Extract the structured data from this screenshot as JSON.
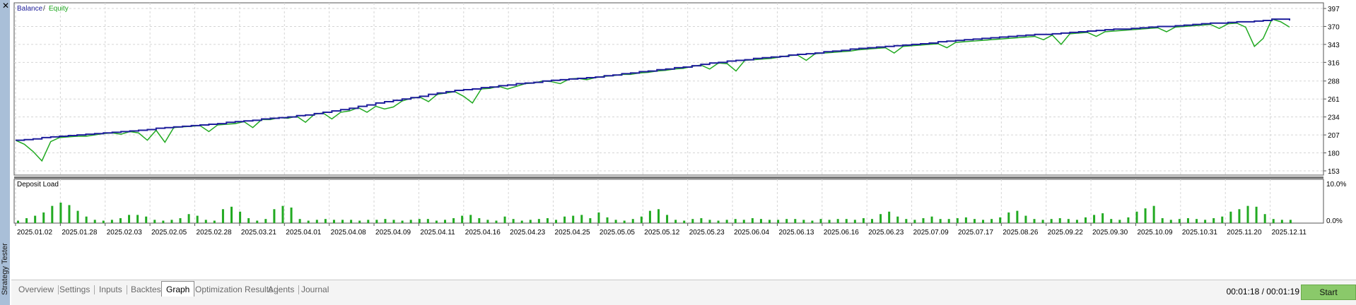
{
  "window": {
    "side_title": "Strategy Tester",
    "close_label": "✕"
  },
  "colors": {
    "balance": "#1f1f9c",
    "equity": "#22aa22",
    "grid": "#d5d5d5",
    "bars": "#22aa22"
  },
  "chart_data": [
    {
      "type": "line",
      "legend": [
        {
          "name": "Balance",
          "color": "#1f1f9c"
        },
        {
          "name": "Equity",
          "color": "#22aa22"
        }
      ],
      "legend_separator": "/",
      "y_ticks": [
        397,
        370,
        343,
        316,
        288,
        261,
        234,
        207,
        180,
        153
      ],
      "ylim": [
        153,
        397
      ],
      "x_ticks": [
        "2025.01.02",
        "2025.01.28",
        "2025.02.03",
        "2025.02.05",
        "2025.02.28",
        "2025.03.21",
        "2025.04.01",
        "2025.04.08",
        "2025.04.09",
        "2025.04.11",
        "2025.04.16",
        "2025.04.23",
        "2025.04.25",
        "2025.05.05",
        "2025.05.12",
        "2025.05.23",
        "2025.06.04",
        "2025.06.13",
        "2025.06.16",
        "2025.06.23",
        "2025.07.09",
        "2025.07.17",
        "2025.08.26",
        "2025.09.22",
        "2025.09.30",
        "2025.10.09",
        "2025.10.31",
        "2025.11.20",
        "2025.12.11"
      ],
      "x": [
        0,
        1,
        2,
        3,
        4,
        5,
        6,
        7,
        8,
        9,
        10,
        11,
        12,
        13,
        14,
        15,
        16,
        17,
        18,
        19,
        20,
        21,
        22,
        23,
        24,
        25,
        26,
        27,
        28,
        29,
        30,
        31,
        32,
        33,
        34,
        35,
        36,
        37,
        38,
        39,
        40,
        41,
        42,
        43,
        44,
        45,
        46,
        47,
        48,
        49,
        50,
        51,
        52,
        53,
        54,
        55,
        56,
        57,
        58,
        59,
        60,
        61,
        62,
        63,
        64,
        65,
        66,
        67,
        68,
        69,
        70,
        71,
        72,
        73,
        74,
        75,
        76,
        77,
        78,
        79,
        80,
        81,
        82,
        83,
        84,
        85,
        86,
        87,
        88,
        89,
        90,
        91,
        92,
        93,
        94,
        95,
        96,
        97,
        98,
        99,
        100,
        101,
        102,
        103,
        104,
        105,
        106,
        107,
        108,
        109,
        110,
        111,
        112,
        113,
        114,
        115,
        116,
        117,
        118,
        119,
        120,
        121,
        122,
        123,
        124,
        125,
        126,
        127,
        128,
        129,
        130,
        131,
        132,
        133,
        134,
        135,
        136,
        137,
        138,
        139,
        140,
        141,
        142,
        143,
        144,
        145
      ],
      "series": [
        {
          "name": "Balance",
          "values": [
            199,
            200,
            201,
            203,
            204,
            205,
            206,
            207,
            208,
            209,
            210,
            211,
            212,
            213,
            214,
            215,
            217,
            218,
            219,
            220,
            221,
            222,
            223,
            224,
            226,
            227,
            228,
            229,
            231,
            232,
            233,
            234,
            236,
            237,
            239,
            241,
            243,
            245,
            247,
            250,
            252,
            255,
            257,
            259,
            261,
            263,
            265,
            268,
            270,
            272,
            274,
            275,
            276,
            278,
            279,
            281,
            282,
            284,
            285,
            286,
            288,
            289,
            290,
            291,
            292,
            293,
            294,
            296,
            297,
            299,
            300,
            302,
            303,
            305,
            306,
            308,
            309,
            311,
            313,
            315,
            316,
            318,
            319,
            320,
            322,
            323,
            324,
            325,
            327,
            328,
            329,
            330,
            332,
            333,
            334,
            336,
            337,
            338,
            339,
            340,
            341,
            342,
            343,
            344,
            345,
            347,
            348,
            349,
            350,
            351,
            352,
            353,
            354,
            355,
            356,
            357,
            358,
            358,
            359,
            360,
            361,
            362,
            363,
            364,
            365,
            366,
            366,
            367,
            368,
            369,
            370,
            370,
            371,
            372,
            373,
            374,
            375,
            375,
            376,
            377,
            377,
            378,
            379,
            381,
            381,
            379
          ]
        },
        {
          "name": "Equity",
          "values": [
            199,
            193,
            182,
            168,
            197,
            203,
            204,
            205,
            205,
            207,
            209,
            210,
            208,
            212,
            210,
            199,
            214,
            196,
            218,
            219,
            220,
            221,
            212,
            222,
            223,
            224,
            227,
            218,
            230,
            230,
            233,
            232,
            235,
            226,
            238,
            240,
            231,
            241,
            243,
            248,
            241,
            250,
            246,
            249,
            258,
            262,
            264,
            257,
            268,
            270,
            272,
            265,
            255,
            276,
            277,
            280,
            276,
            280,
            284,
            285,
            288,
            287,
            284,
            291,
            292,
            290,
            293,
            295,
            296,
            298,
            298,
            300,
            301,
            303,
            304,
            306,
            307,
            310,
            312,
            306,
            315,
            314,
            303,
            319,
            320,
            321,
            322,
            324,
            326,
            327,
            319,
            329,
            330,
            331,
            332,
            333,
            335,
            336,
            337,
            338,
            330,
            340,
            341,
            342,
            343,
            344,
            338,
            346,
            347,
            348,
            349,
            350,
            351,
            352,
            353,
            354,
            355,
            350,
            357,
            343,
            359,
            360,
            361,
            355,
            362,
            363,
            364,
            365,
            366,
            367,
            368,
            362,
            369,
            370,
            371,
            372,
            373,
            367,
            374,
            375,
            369,
            340,
            352,
            381,
            377,
            369
          ]
        }
      ]
    },
    {
      "type": "bar",
      "title": "Deposit Load",
      "y_ticks": [
        "10.0%",
        "0.0%"
      ],
      "ylim": [
        0,
        10
      ],
      "values_pct": [
        0.6,
        1.2,
        1.8,
        2.6,
        4.2,
        5.0,
        4.4,
        3.0,
        1.6,
        0.8,
        0.6,
        0.8,
        1.2,
        2.0,
        2.0,
        1.6,
        0.8,
        0.6,
        0.8,
        1.2,
        2.2,
        1.8,
        0.8,
        0.6,
        3.4,
        4.0,
        2.8,
        1.2,
        0.6,
        1.0,
        3.4,
        4.2,
        3.8,
        1.0,
        0.6,
        0.8,
        1.0,
        0.8,
        0.8,
        0.8,
        0.6,
        0.8,
        0.8,
        1.0,
        0.8,
        0.6,
        0.8,
        1.0,
        1.0,
        0.6,
        0.8,
        1.2,
        1.8,
        2.0,
        1.2,
        0.8,
        0.6,
        1.6,
        1.0,
        0.6,
        0.8,
        1.0,
        1.2,
        0.8,
        1.6,
        1.8,
        2.0,
        1.2,
        2.6,
        1.4,
        0.8,
        0.6,
        1.0,
        1.6,
        3.0,
        3.4,
        2.0,
        0.8,
        0.6,
        1.0,
        1.2,
        0.8,
        0.6,
        0.8,
        1.0,
        0.8,
        1.2,
        1.0,
        0.8,
        0.8,
        1.0,
        1.0,
        0.8,
        0.6,
        1.0,
        0.8,
        1.0,
        1.0,
        0.8,
        1.2,
        1.0,
        2.2,
        2.8,
        1.6,
        1.0,
        0.8,
        1.2,
        1.6,
        1.0,
        1.0,
        1.2,
        1.4,
        1.0,
        0.8,
        1.0,
        1.4,
        2.6,
        3.0,
        1.8,
        1.0,
        0.8,
        1.0,
        1.2,
        1.0,
        0.8,
        1.4,
        2.0,
        2.4,
        1.0,
        0.8,
        1.4,
        2.8,
        3.6,
        4.2,
        1.2,
        0.8,
        1.0,
        1.2,
        1.0,
        0.8,
        1.2,
        1.6,
        2.8,
        3.4,
        4.2,
        4.0,
        2.2,
        1.0,
        0.8,
        0.8
      ]
    }
  ],
  "tabs": [
    {
      "label": "Overview",
      "active": false
    },
    {
      "label": "Settings",
      "active": false
    },
    {
      "label": "Inputs",
      "active": false
    },
    {
      "label": "Backtest",
      "active": false
    },
    {
      "label": "Graph",
      "active": true
    },
    {
      "label": "Optimization Results",
      "active": false
    },
    {
      "label": "Agents",
      "active": false
    },
    {
      "label": "Journal",
      "active": false
    }
  ],
  "timer": "00:01:18 / 00:01:19",
  "start_label": "Start"
}
